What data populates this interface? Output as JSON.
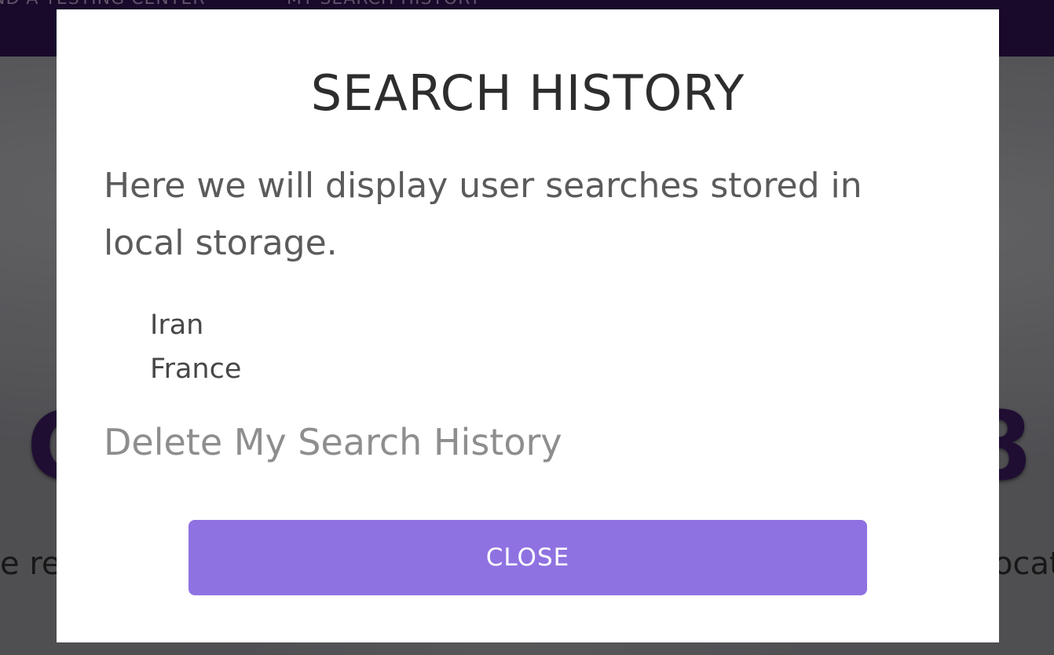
{
  "background": {
    "nav_links": [
      "ND A TESTING CENTER",
      "MY SEARCH HISTORY"
    ],
    "hero_left": "C",
    "hero_right": "8",
    "sub_left": "e re",
    "sub_right": "ocat"
  },
  "modal": {
    "title": "SEARCH HISTORY",
    "description": "Here we will display user searches stored in local storage.",
    "history": [
      "Iran",
      "France"
    ],
    "delete_label": "Delete My Search History",
    "close_label": "CLOSE"
  },
  "colors": {
    "accent": "#8f72e1",
    "nav": "#1d0b30"
  }
}
